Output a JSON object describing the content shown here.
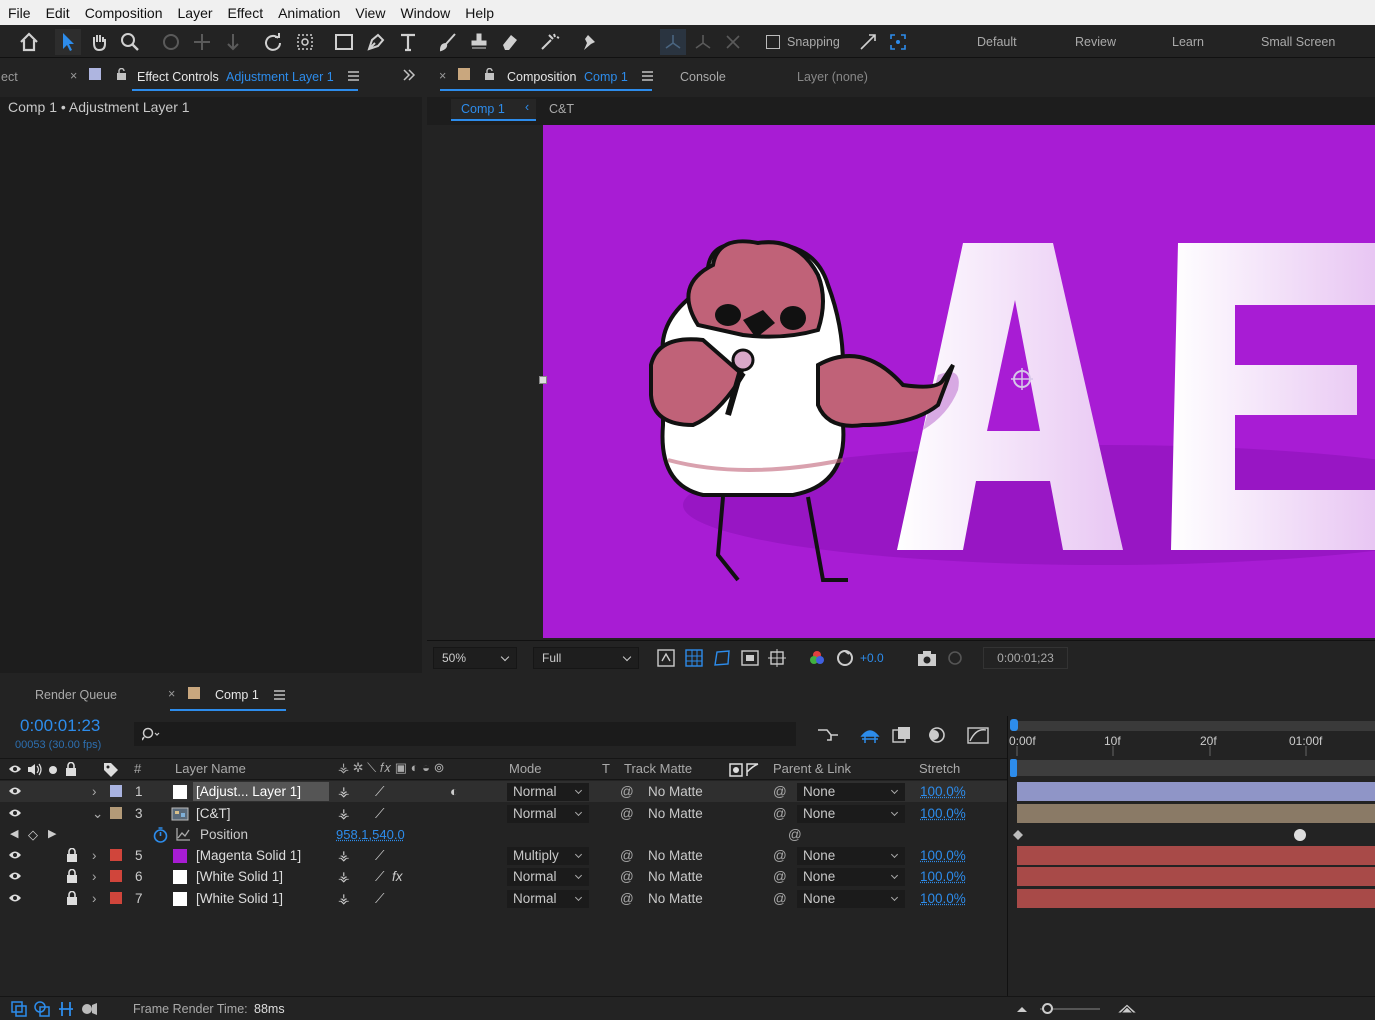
{
  "menu": [
    "File",
    "Edit",
    "Composition",
    "Layer",
    "Effect",
    "Animation",
    "View",
    "Window",
    "Help"
  ],
  "toolbar": {
    "snapping_label": "Snapping",
    "workspaces": [
      "Default",
      "Review",
      "Learn",
      "Small Screen"
    ]
  },
  "left_panel": {
    "cut_tab": "ect",
    "tab_title": "Effect Controls",
    "tab_subject": "Adjustment Layer 1",
    "breadcrumb": "Comp 1 • Adjustment Layer 1"
  },
  "comp_panel": {
    "tab_title": "Composition",
    "tab_subject": "Comp 1",
    "tab_console": "Console",
    "tab_layer": "Layer (none)",
    "subtabs": [
      "Comp 1",
      "C&T"
    ]
  },
  "viewer": {
    "canvas_color": "#a81cd4",
    "canvas_text": "AE",
    "zoom": "50%",
    "resolution": "Full",
    "exposure": "+0.0",
    "timecode": "0:00:01;23"
  },
  "timeline": {
    "tab_render_queue": "Render Queue",
    "tab_comp": "Comp 1",
    "timecode": "0:00:01:23",
    "frame_info": "00053 (30.00 fps)",
    "search_placeholder": "",
    "ruler": [
      "0:00f",
      "10f",
      "20f",
      "01:00f"
    ],
    "columns": {
      "hash": "#",
      "layer_name": "Layer Name",
      "mode": "Mode",
      "t": "T",
      "track_matte": "Track Matte",
      "parent": "Parent & Link",
      "stretch": "Stretch"
    },
    "layers": [
      {
        "num": "1",
        "name": "[Adjust... Layer 1]",
        "label": "#a9b3e0",
        "swatch": "#ffffff",
        "mode": "Normal",
        "matte": "No Matte",
        "parent": "None",
        "stretch": "100.0%",
        "bar": "#8f95c7",
        "lock": false,
        "twirl": ">",
        "fx": false,
        "selected": true
      },
      {
        "num": "3",
        "name": "[C&T]",
        "label": "#b39a78",
        "swatch": "comp",
        "mode": "Normal",
        "matte": "No Matte",
        "parent": "None",
        "stretch": "100.0%",
        "bar": "#8a7a66",
        "lock": false,
        "twirl": "v",
        "fx": false,
        "selected": false
      },
      {
        "num": "5",
        "name": "[Magenta Solid 1]",
        "label": "#d0453b",
        "swatch": "#a81cd4",
        "mode": "Multiply",
        "matte": "No Matte",
        "parent": "None",
        "stretch": "100.0%",
        "bar": "#a84a48",
        "lock": true,
        "twirl": ">",
        "fx": false,
        "selected": false
      },
      {
        "num": "6",
        "name": "[White Solid 1]",
        "label": "#d0453b",
        "swatch": "#ffffff",
        "mode": "Normal",
        "matte": "No Matte",
        "parent": "None",
        "stretch": "100.0%",
        "bar": "#a84a48",
        "lock": true,
        "twirl": ">",
        "fx": true,
        "selected": false
      },
      {
        "num": "7",
        "name": "[White Solid 1]",
        "label": "#d0453b",
        "swatch": "#ffffff",
        "mode": "Normal",
        "matte": "No Matte",
        "parent": "None",
        "stretch": "100.0%",
        "bar": "#a84a48",
        "lock": true,
        "twirl": ">",
        "fx": false,
        "selected": false
      }
    ],
    "property": {
      "name": "Position",
      "value": "958.1,540.0"
    },
    "footer": {
      "label": "Frame Render Time:",
      "value": "88ms"
    }
  }
}
